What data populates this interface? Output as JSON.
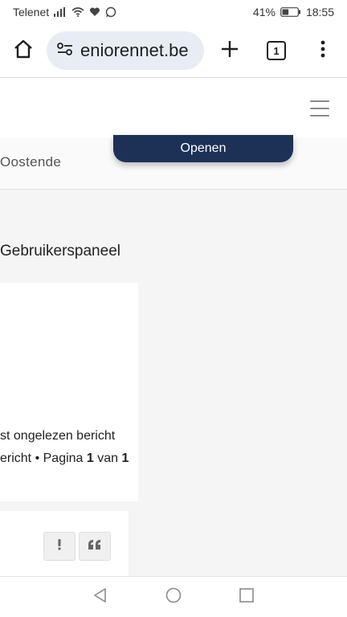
{
  "status_bar": {
    "carrier": "Telenet",
    "battery_percent": "41%",
    "time": "18:55",
    "icons": [
      "signal-icon",
      "wifi-icon",
      "heartbeat-icon",
      "whatsapp-icon",
      "battery-icon"
    ],
    "battery_level": 0.41
  },
  "browser": {
    "url": "eniorennet.be",
    "tab_count": "1",
    "icons": [
      "home-icon",
      "site-settings-icon",
      "new-tab-icon",
      "tabs-icon",
      "more-icon"
    ]
  },
  "site": {
    "location": "Oostende",
    "open_button": "Openen",
    "panel_title": "Gebruikerspaneel",
    "unread_link": "st ongelezen bericht",
    "pagination": {
      "prefix": "ericht • Pagina ",
      "page": "1",
      "middle": " van ",
      "total": "1"
    },
    "post_buttons": [
      "report-icon",
      "quote-icon"
    ]
  },
  "colors": {
    "accent": "#1d3157",
    "url_pill": "#e8edf5",
    "page_bg": "#f5f5f5"
  }
}
